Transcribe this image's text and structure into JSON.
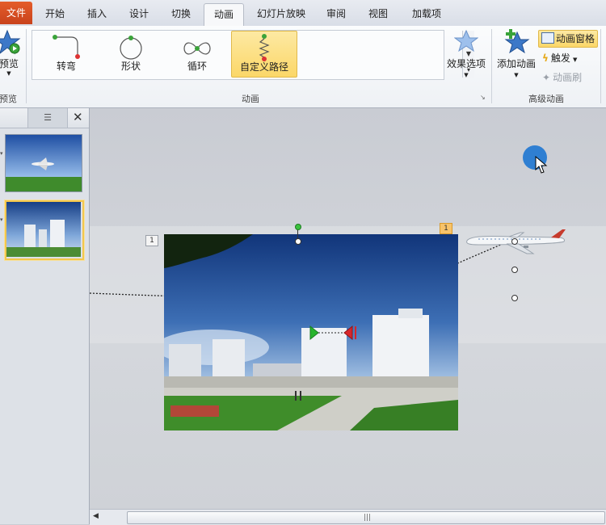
{
  "tabs": [
    "文件",
    "开始",
    "插入",
    "设计",
    "切换",
    "动画",
    "幻灯片放映",
    "审阅",
    "视图",
    "加载项"
  ],
  "ribbon": {
    "preview_label": "预览",
    "preview_group": "预览",
    "animation_group": "动画",
    "advanced_group": "高级动画",
    "gallery": [
      "转弯",
      "形状",
      "循环",
      "自定义路径"
    ],
    "effect_options": "效果选项",
    "add_animation": "添加动画",
    "animation_pane": "动画窗格",
    "trigger": "触发",
    "animation_painter": "动画刷"
  },
  "badges": {
    "left": "1",
    "right": "1"
  },
  "colors": {
    "file_tab": "#d14f22",
    "selected": "#fbd768",
    "accent": "#2f7fd2"
  }
}
